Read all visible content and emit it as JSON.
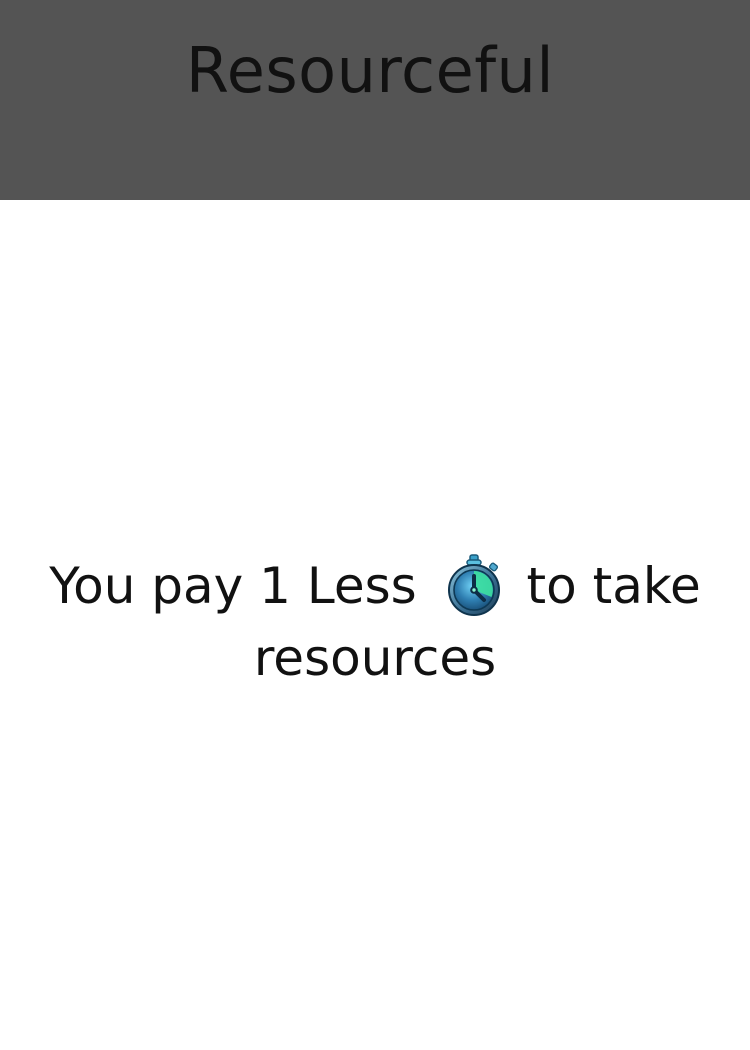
{
  "card": {
    "title": "Resourceful",
    "text_before_icon": "You pay 1 Less",
    "icon": "stopwatch-time-icon",
    "text_after_icon": "to take resources"
  },
  "colors": {
    "header_background": "#545454",
    "card_background": "#ffffff",
    "text": "#111111",
    "icon_primary": "#2f7fb2",
    "icon_accent": "#3de0a2"
  }
}
